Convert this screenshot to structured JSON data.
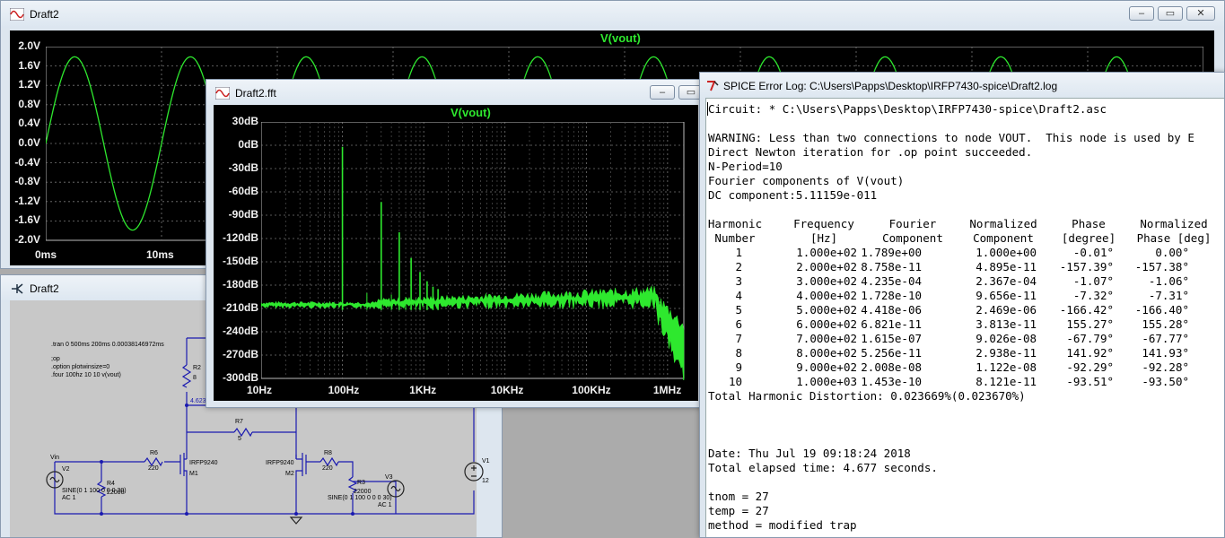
{
  "transient_window": {
    "title": "Draft2",
    "trace_label": "V(vout)",
    "y_ticks": [
      "2.0V",
      "1.6V",
      "1.2V",
      "0.8V",
      "0.4V",
      "0.0V",
      "-0.4V",
      "-0.8V",
      "-1.2V",
      "-1.6V",
      "-2.0V"
    ],
    "x_ticks": [
      "0ms",
      "10ms"
    ]
  },
  "schematic_window": {
    "title": "Draft2",
    "directives": [
      ".tran 0 500ms 200ms 0.00038146972ms",
      ";op",
      ".option plotwinsize=0",
      ".four 100hz 10 10 v(vout)"
    ],
    "parts": {
      "r2": "R2",
      "r2_val": "8",
      "node_voltage": "4.623",
      "r7": "R7",
      "r7_val": "5",
      "vin": "Vin",
      "v2": "V2",
      "v2_src": "SINE(0 1 100 0 0 0 30)",
      "v2_ac": "AC 1",
      "r4": "R4",
      "r4_val": "22000",
      "r6": "R6",
      "r6_val": "220",
      "m1_model": "IRFP9240",
      "m1": "M1",
      "m2_model": "IRFP9240",
      "m2": "M2",
      "r8": "R8",
      "r8_val": "220",
      "r3": "R3",
      "r3_val": "22000",
      "v3": "V3",
      "v3_src": "SINE(0 1 100 0 0 0 30)",
      "v3_ac": "AC 1",
      "v1": "V1",
      "v1_val": "12"
    }
  },
  "fft_window": {
    "title": "Draft2.fft",
    "trace_label": "V(vout)",
    "y_ticks": [
      "30dB",
      "0dB",
      "-30dB",
      "-60dB",
      "-90dB",
      "-120dB",
      "-150dB",
      "-180dB",
      "-210dB",
      "-240dB",
      "-270dB",
      "-300dB"
    ],
    "x_ticks": [
      "10Hz",
      "100Hz",
      "1KHz",
      "10KHz",
      "100KHz",
      "1MHz"
    ]
  },
  "log_window": {
    "title": "SPICE Error Log: C:\\Users\\Papps\\Desktop\\IRFP7430-spice\\Draft2.log",
    "header_lines": [
      "Circuit: * C:\\Users\\Papps\\Desktop\\IRFP7430-spice\\Draft2.asc",
      "",
      "WARNING: Less than two connections to node VOUT.  This node is used by E",
      "Direct Newton iteration for .op point succeeded.",
      "N-Period=10",
      "Fourier components of V(vout)",
      "DC component:5.11159e-011"
    ],
    "table_header": [
      [
        "Harmonic",
        "Frequency",
        "Fourier",
        "Normalized",
        "Phase",
        "Normalized"
      ],
      [
        "Number",
        "[Hz]",
        "Component",
        "Component",
        "[degree]",
        "Phase [deg]"
      ]
    ],
    "rows": [
      [
        "1",
        "1.000e+02",
        "1.789e+00",
        "1.000e+00",
        "-0.01°",
        "0.00°"
      ],
      [
        "2",
        "2.000e+02",
        "8.758e-11",
        "4.895e-11",
        "-157.39°",
        "-157.38°"
      ],
      [
        "3",
        "3.000e+02",
        "4.235e-04",
        "2.367e-04",
        "-1.07°",
        "-1.06°"
      ],
      [
        "4",
        "4.000e+02",
        "1.728e-10",
        "9.656e-11",
        "-7.32°",
        "-7.31°"
      ],
      [
        "5",
        "5.000e+02",
        "4.418e-06",
        "2.469e-06",
        "-166.42°",
        "-166.40°"
      ],
      [
        "6",
        "6.000e+02",
        "6.821e-11",
        "3.813e-11",
        "155.27°",
        "155.28°"
      ],
      [
        "7",
        "7.000e+02",
        "1.615e-07",
        "9.026e-08",
        "-67.79°",
        "-67.77°"
      ],
      [
        "8",
        "8.000e+02",
        "5.256e-11",
        "2.938e-11",
        "141.92°",
        "141.93°"
      ],
      [
        "9",
        "9.000e+02",
        "2.008e-08",
        "1.122e-08",
        "-92.29°",
        "-92.28°"
      ],
      [
        "10",
        "1.000e+03",
        "1.453e-10",
        "8.121e-11",
        "-93.51°",
        "-93.50°"
      ]
    ],
    "thd_line": "Total Harmonic Distortion: 0.023669%(0.023670%)",
    "footer_lines": [
      "Date: Thu Jul 19 09:18:24 2018",
      "Total elapsed time: 4.677 seconds.",
      "",
      "tnom = 27",
      "temp = 27",
      "method = modified trap"
    ]
  }
}
